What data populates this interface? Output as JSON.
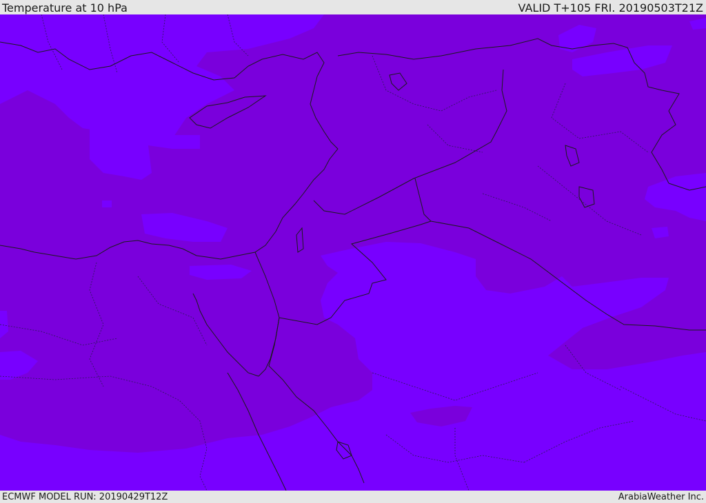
{
  "header": {
    "title": "Temperature at 10 hPa",
    "valid": "VALID T+105 FRI. 20190503T21Z"
  },
  "footer": {
    "model_run": "ECMWF MODEL RUN: 20190429T12Z",
    "brand": "ArabiaWeather Inc."
  },
  "colors": {
    "dark_band": "#7a00dc",
    "light_band": "#7800ff",
    "border": "#1b1b1b"
  }
}
